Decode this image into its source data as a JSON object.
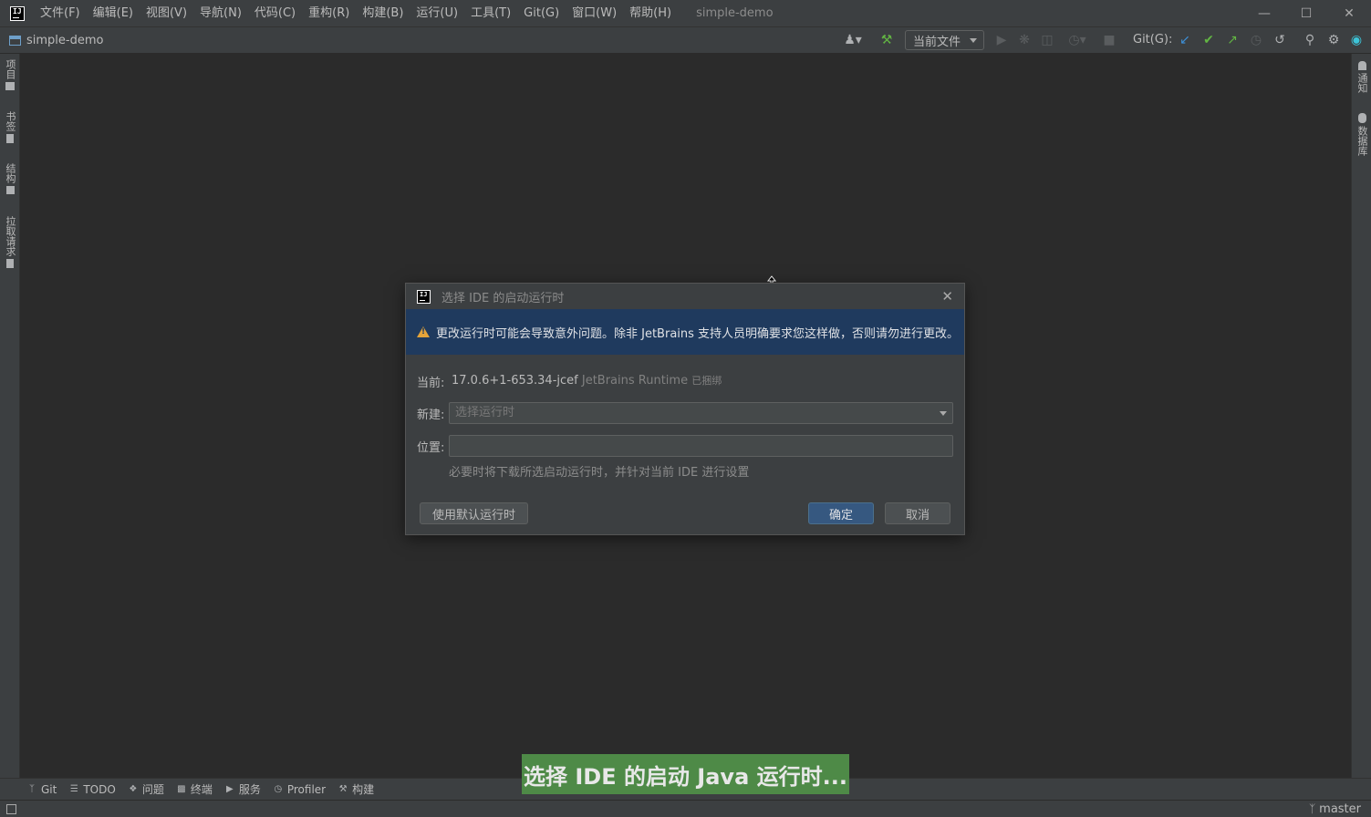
{
  "titlebar": {
    "menus": [
      "文件(F)",
      "编辑(E)",
      "视图(V)",
      "导航(N)",
      "代码(C)",
      "重构(R)",
      "构建(B)",
      "运行(U)",
      "工具(T)",
      "Git(G)",
      "窗口(W)",
      "帮助(H)"
    ],
    "window_title": "simple-demo"
  },
  "navbar": {
    "project_name": "simple-demo",
    "run_config": "当前文件",
    "git_label": "Git(G):"
  },
  "left_stripe": {
    "tabs": [
      "项目",
      "书签",
      "结构",
      "拉取请求"
    ]
  },
  "right_stripe": {
    "tabs": [
      "通知",
      "数据库"
    ]
  },
  "bottom_tools": {
    "items": [
      "Git",
      "TODO",
      "问题",
      "终端",
      "服务",
      "Profiler",
      "构建"
    ]
  },
  "statusbar": {
    "branch": "master"
  },
  "caption": "选择 IDE 的启动 Java 运行时...",
  "dialog": {
    "title": "选择 IDE 的启动运行时",
    "warning": "更改运行时可能会导致意外问题。除非 JetBrains 支持人员明确要求您这样做，否则请勿进行更改。",
    "current_label": "当前:",
    "current_version": "17.0.6+1-653.34-jcef",
    "current_vendor": "JetBrains Runtime",
    "current_status": "已捆绑",
    "new_label": "新建:",
    "new_placeholder": "选择运行时",
    "location_label": "位置:",
    "location_value": "",
    "hint": "必要时将下载所选启动运行时，并针对当前 IDE 进行设置",
    "btn_default": "使用默认运行时",
    "btn_ok": "确定",
    "btn_cancel": "取消"
  },
  "colors": {
    "banner": "#1f3a5e",
    "ok_button": "#365880",
    "caption_bg": "#4e8a47",
    "warning": "#e5a43a"
  }
}
